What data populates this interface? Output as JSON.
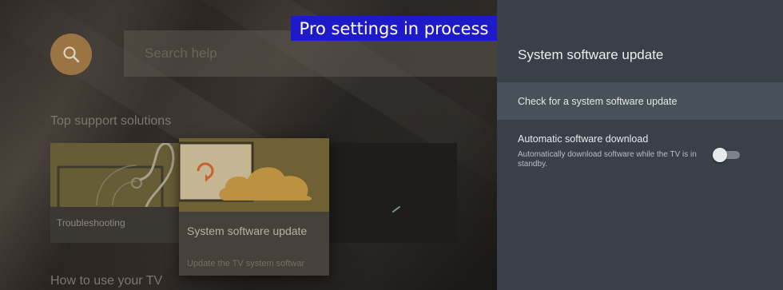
{
  "overlay": {
    "banner_text": "Pro settings in process"
  },
  "help": {
    "search_placeholder": "Search help",
    "section_top": "Top support solutions",
    "section_howto": "How to use your TV",
    "cards": [
      {
        "label": "Troubleshooting",
        "icon": "stethoscope-icon"
      },
      {
        "title": "System software update",
        "subtitle": "Update the TV system softwar",
        "icon": "sync-cloud-icon"
      },
      {
        "label": "",
        "icon": "feather-icon"
      }
    ]
  },
  "settings_panel": {
    "title": "System software update",
    "check_update_label": "Check for a system software update",
    "auto_download": {
      "label": "Automatic software download",
      "description": "Automatically download software while the TV is in standby.",
      "enabled": false
    }
  },
  "colors": {
    "overlay_banner": "#1e1ac9",
    "panel_bg": "#394048",
    "panel_selected_row": "#48505a",
    "search_accent": "#9a7442"
  }
}
